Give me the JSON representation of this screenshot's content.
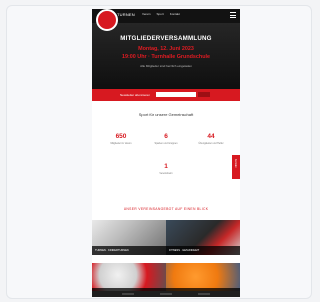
{
  "site": {
    "brand": "TURNEN",
    "nav": [
      "Verein",
      "Sport",
      "Kontakt"
    ]
  },
  "hero": {
    "title": "MITGLIEDERVERSAMMLUNG",
    "date": "Montag, 12. Juni 2023",
    "time": "19:00 Uhr · Turnhalle Grundschule",
    "subtitle": "Alle Mitglieder sind herzlich eingeladen"
  },
  "band": {
    "label": "Newsletter abonnieren",
    "input_placeholder": "",
    "button_label": ""
  },
  "stats": {
    "title": "Sport für unsere Gemeinschaft",
    "items": [
      {
        "value": "650",
        "label": "Mitglieder im Verein"
      },
      {
        "value": "6",
        "label": "Sparten und Gruppen"
      },
      {
        "value": "44",
        "label": "Übungsleiter und Helfer"
      },
      {
        "value": "1",
        "label": "Vereinsheim"
      }
    ]
  },
  "side_tab": {
    "label": "Kontakt"
  },
  "section": {
    "heading": "UNSER VEREINSANGEBOT AUF EINEN BLICK"
  },
  "tiles": [
    {
      "caption": "TURNEN · KINDERTURNEN"
    },
    {
      "caption": "FITNESS · GESUNDHEIT"
    },
    {
      "caption": "TANZEN"
    },
    {
      "caption": "BALLSPORT"
    }
  ],
  "colors": {
    "accent": "#d71920",
    "dark": "#121212"
  }
}
